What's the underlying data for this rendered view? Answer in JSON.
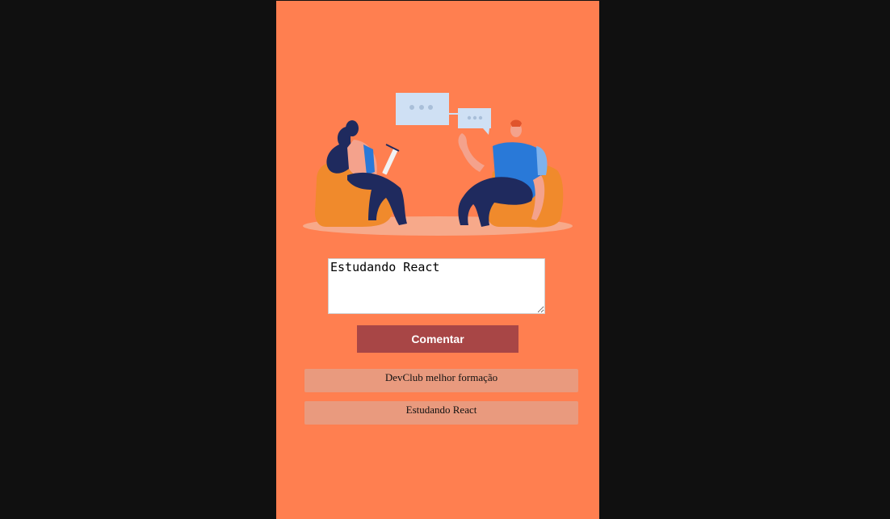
{
  "colors": {
    "background": "#101010",
    "panel": "#ff7f50",
    "button": "#a84646",
    "comment_item": "#e99a7e"
  },
  "illustration": {
    "icon": "two-people-talking-illustration"
  },
  "comment_form": {
    "input_value": "Estudando React",
    "submit_label": "Comentar"
  },
  "comments": [
    {
      "text": "DevClub melhor formação"
    },
    {
      "text": "Estudando React"
    }
  ]
}
